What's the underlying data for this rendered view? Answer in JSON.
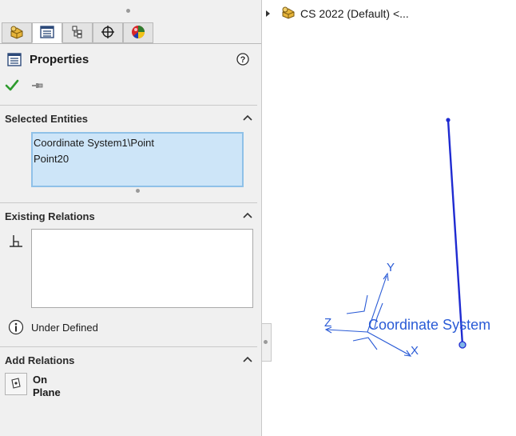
{
  "panel": {
    "title": "Properties",
    "tabs": [
      {
        "name": "feature-manager",
        "active": false
      },
      {
        "name": "property-manager",
        "active": true
      },
      {
        "name": "configuration-manager",
        "active": false
      },
      {
        "name": "dimxpert-manager",
        "active": false
      },
      {
        "name": "display-manager",
        "active": false
      }
    ],
    "selected_entities": {
      "title": "Selected Entities",
      "items": [
        "Coordinate System1\\Point",
        "Point20"
      ]
    },
    "existing_relations": {
      "title": "Existing Relations",
      "status": "Under Defined"
    },
    "add_relations": {
      "title": "Add Relations",
      "on_plane_line1": "On",
      "on_plane_line2": "Plane"
    }
  },
  "graphics": {
    "tree_label": "CS 2022 (Default) <...",
    "coordinate_label": "Coordinate System",
    "axis_x": "X",
    "axis_y": "Y",
    "axis_z": "Z",
    "sketch_color": "#1f2bd1",
    "triad_color": "#2a5bd6"
  }
}
